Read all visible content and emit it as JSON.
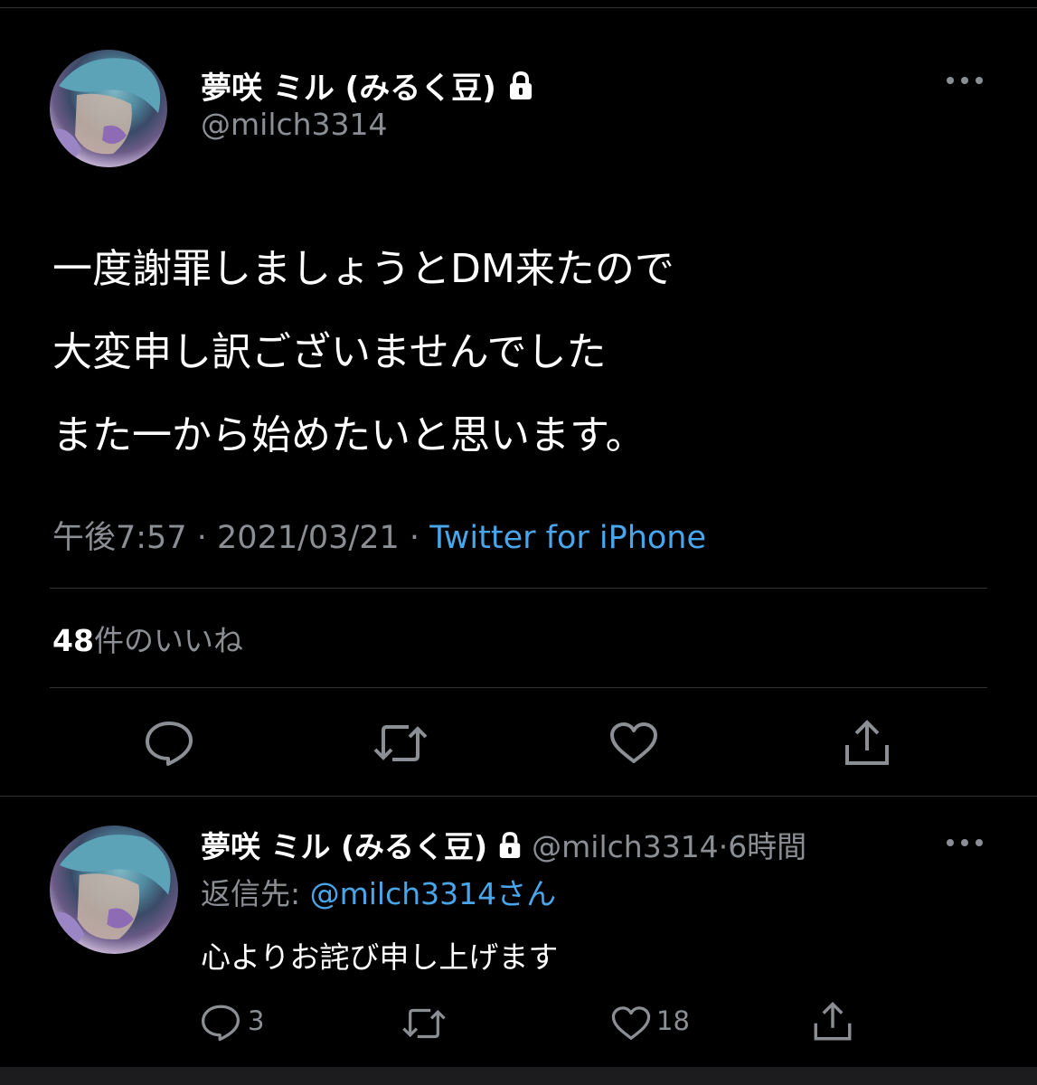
{
  "main_tweet": {
    "display_name": "夢咲 ミル (みるく豆)",
    "handle": "@milch3314",
    "text_lines": [
      "一度謝罪しましょうとDM来たので",
      "大変申し訳ございませんでした",
      "また一から始めたいと思います。"
    ],
    "time": "午後7:57",
    "date": "2021/03/21",
    "source": "Twitter for iPhone",
    "likes_count": "48",
    "likes_label": "件のいいね"
  },
  "reply_tweet": {
    "display_name": "夢咲 ミル (みるく豆)",
    "handle": "@milch3314",
    "age": "6時間",
    "reply_to_label": "返信先: ",
    "reply_to_mention": "@milch3314さん",
    "text": "心よりお詫び申し上げます",
    "reply_count": "3",
    "like_count": "18"
  },
  "separators": {
    "dot": "·"
  },
  "icons": {
    "lock": "lock-icon",
    "more": "more-icon",
    "reply": "reply-icon",
    "retweet": "retweet-icon",
    "like": "heart-icon",
    "share": "share-icon"
  },
  "colors": {
    "background": "#000000",
    "text": "#ffffff",
    "muted": "#8b8f94",
    "link": "#4aa6ea",
    "divider": "#2f3336"
  }
}
